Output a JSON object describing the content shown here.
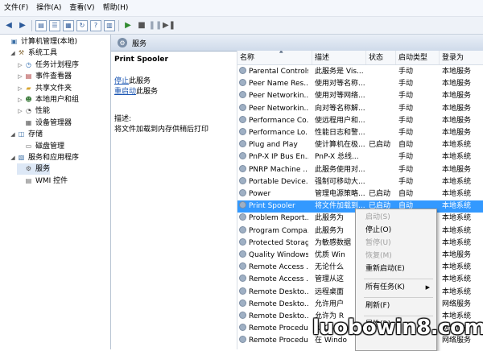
{
  "menubar": [
    {
      "name": "menu-file",
      "label": "文件(F)"
    },
    {
      "name": "menu-action",
      "label": "操作(A)"
    },
    {
      "name": "menu-view",
      "label": "查看(V)"
    },
    {
      "name": "menu-help",
      "label": "帮助(H)"
    }
  ],
  "tree": [
    {
      "name": "tree-root",
      "label": "计算机管理(本地)",
      "icon": "computer-icon",
      "level": 0,
      "toggle": ""
    },
    {
      "name": "tree-system-tools",
      "label": "系统工具",
      "icon": "toolbox-icon",
      "level": 1,
      "toggle": "◢"
    },
    {
      "name": "tree-task-scheduler",
      "label": "任务计划程序",
      "icon": "clock-icon",
      "level": 2,
      "toggle": "▷"
    },
    {
      "name": "tree-event-viewer",
      "label": "事件查看器",
      "icon": "log-icon",
      "level": 2,
      "toggle": "▷"
    },
    {
      "name": "tree-shared-folders",
      "label": "共享文件夹",
      "icon": "folder-icon",
      "level": 2,
      "toggle": "▷"
    },
    {
      "name": "tree-local-users",
      "label": "本地用户和组",
      "icon": "users-icon",
      "level": 2,
      "toggle": "▷"
    },
    {
      "name": "tree-performance",
      "label": "性能",
      "icon": "performance-icon",
      "level": 2,
      "toggle": "▷"
    },
    {
      "name": "tree-device-manager",
      "label": "设备管理器",
      "icon": "device-icon",
      "level": 2,
      "toggle": ""
    },
    {
      "name": "tree-storage",
      "label": "存储",
      "icon": "storage-icon",
      "level": 1,
      "toggle": "◢"
    },
    {
      "name": "tree-disk-management",
      "label": "磁盘管理",
      "icon": "disk-icon",
      "level": 2,
      "toggle": ""
    },
    {
      "name": "tree-services-apps",
      "label": "服务和应用程序",
      "icon": "services-icon",
      "level": 1,
      "toggle": "◢"
    },
    {
      "name": "tree-services",
      "label": "服务",
      "icon": "gear-icon",
      "level": 2,
      "toggle": "",
      "selected": true
    },
    {
      "name": "tree-wmi",
      "label": "WMI 控件",
      "icon": "wmi-icon",
      "level": 2,
      "toggle": ""
    }
  ],
  "content_header": "服务",
  "detail": {
    "service_name": "Print Spooler",
    "stop_link": "停止",
    "stop_suffix": "此服务",
    "restart_link": "重启动",
    "restart_suffix": "此服务",
    "desc_label": "描述:",
    "desc_text": "将文件加载到内存供稍后打印"
  },
  "columns": [
    "名称",
    "描述",
    "状态",
    "启动类型",
    "登录为"
  ],
  "services": [
    {
      "name": "Parental Controls",
      "desc": "此服务是 Vis...",
      "status": "",
      "startup": "手动",
      "logon": "本地服务"
    },
    {
      "name": "Peer Name Res...",
      "desc": "使用对等名称...",
      "status": "",
      "startup": "手动",
      "logon": "本地服务"
    },
    {
      "name": "Peer Networkin...",
      "desc": "使用对等网络...",
      "status": "",
      "startup": "手动",
      "logon": "本地服务"
    },
    {
      "name": "Peer Networkin...",
      "desc": "向对等名称解...",
      "status": "",
      "startup": "手动",
      "logon": "本地服务"
    },
    {
      "name": "Performance Co...",
      "desc": "使远程用户和...",
      "status": "",
      "startup": "手动",
      "logon": "本地服务"
    },
    {
      "name": "Performance Lo...",
      "desc": "性能日志和警...",
      "status": "",
      "startup": "手动",
      "logon": "本地服务"
    },
    {
      "name": "Plug and Play",
      "desc": "使计算机在极...",
      "status": "已启动",
      "startup": "自动",
      "logon": "本地系统"
    },
    {
      "name": "PnP-X IP Bus En...",
      "desc": "PnP-X 总线...",
      "status": "",
      "startup": "手动",
      "logon": "本地系统"
    },
    {
      "name": "PNRP Machine ...",
      "desc": "此服务使用对...",
      "status": "",
      "startup": "手动",
      "logon": "本地服务"
    },
    {
      "name": "Portable Device...",
      "desc": "强制可移动大...",
      "status": "",
      "startup": "手动",
      "logon": "本地系统"
    },
    {
      "name": "Power",
      "desc": "管理电源策略...",
      "status": "已启动",
      "startup": "自动",
      "logon": "本地系统"
    },
    {
      "name": "Print Spooler",
      "desc": "将文件加载到...",
      "status": "已启动",
      "startup": "自动",
      "logon": "本地系统",
      "selected": true
    },
    {
      "name": "Problem Report...",
      "desc": "此服务为",
      "status": "",
      "startup": "",
      "logon": "本地系统"
    },
    {
      "name": "Program Compa...",
      "desc": "此服务为",
      "status": "",
      "startup": "",
      "logon": "本地系统"
    },
    {
      "name": "Protected Storage",
      "desc": "为敏感数据",
      "status": "",
      "startup": "",
      "logon": "本地系统"
    },
    {
      "name": "Quality Windows...",
      "desc": "优质 Win",
      "status": "",
      "startup": "",
      "logon": "本地服务"
    },
    {
      "name": "Remote Access ...",
      "desc": "无论什么",
      "status": "",
      "startup": "",
      "logon": "本地系统"
    },
    {
      "name": "Remote Access ...",
      "desc": "管理从这",
      "status": "",
      "startup": "",
      "logon": "本地系统"
    },
    {
      "name": "Remote Deskto...",
      "desc": "远程桌面",
      "status": "",
      "startup": "",
      "logon": "本地系统"
    },
    {
      "name": "Remote Deskto...",
      "desc": "允许用户",
      "status": "",
      "startup": "",
      "logon": "网络服务"
    },
    {
      "name": "Remote Deskto...",
      "desc": "允许为 R",
      "status": "",
      "startup": "",
      "logon": "本地系统"
    },
    {
      "name": "Remote Procedu...",
      "desc": "RPCSS",
      "status": "",
      "startup": "",
      "logon": "网络服务"
    },
    {
      "name": "Remote Procedu...",
      "desc": "在 Windo",
      "status": "",
      "startup": "",
      "logon": "网络服务"
    }
  ],
  "context_menu": [
    {
      "name": "ctx-start",
      "label": "启动(S)",
      "disabled": true
    },
    {
      "name": "ctx-stop",
      "label": "停止(O)",
      "disabled": false
    },
    {
      "name": "ctx-pause",
      "label": "暂停(U)",
      "disabled": true
    },
    {
      "name": "ctx-resume",
      "label": "恢复(M)",
      "disabled": true
    },
    {
      "name": "ctx-restart",
      "label": "重新启动(E)",
      "disabled": false
    },
    {
      "sep": true
    },
    {
      "name": "ctx-all-tasks",
      "label": "所有任务(K)",
      "disabled": false,
      "submenu": true
    },
    {
      "sep": true
    },
    {
      "name": "ctx-refresh",
      "label": "刷新(F)",
      "disabled": false
    },
    {
      "sep": true
    },
    {
      "name": "ctx-properties",
      "label": "属性(R)",
      "disabled": false
    }
  ],
  "watermark": "luobowin8.com"
}
